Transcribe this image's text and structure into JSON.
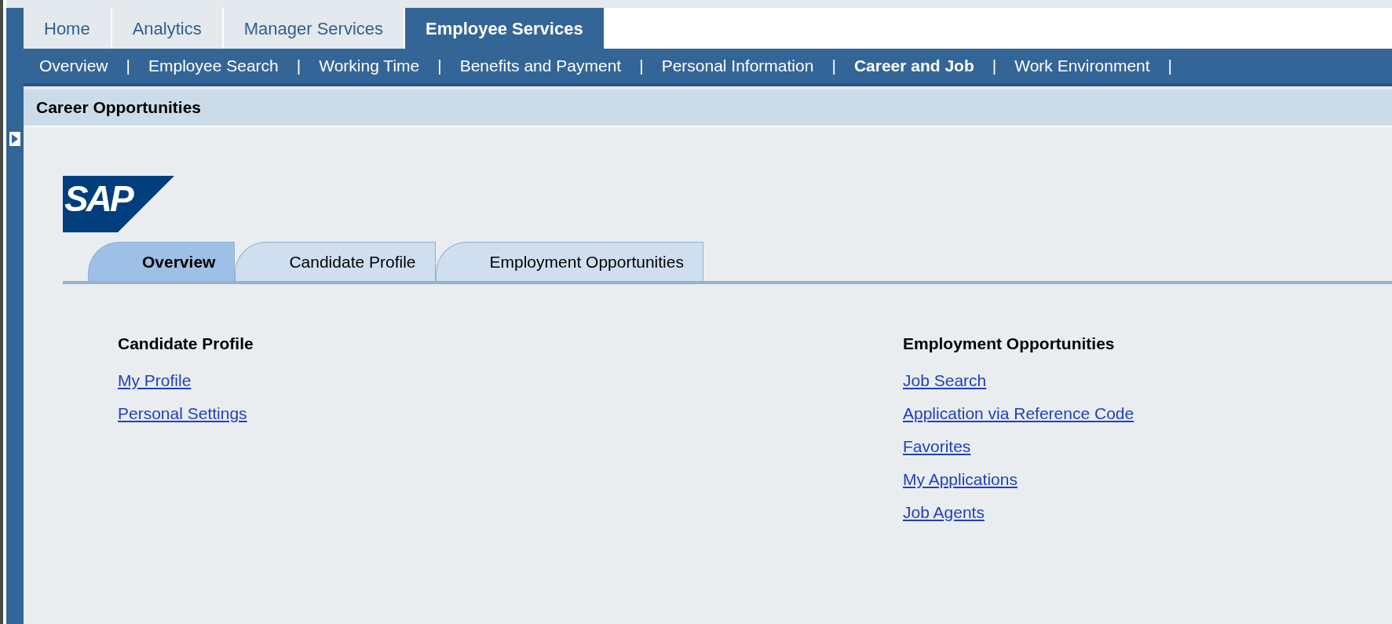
{
  "top_tabs": [
    {
      "label": "Home",
      "selected": false
    },
    {
      "label": "Analytics",
      "selected": false
    },
    {
      "label": "Manager Services",
      "selected": false
    },
    {
      "label": "Employee Services",
      "selected": true
    }
  ],
  "sub_nav": [
    {
      "label": "Overview",
      "selected": false
    },
    {
      "label": "Employee Search",
      "selected": false
    },
    {
      "label": "Working Time",
      "selected": false
    },
    {
      "label": "Benefits and Payment",
      "selected": false
    },
    {
      "label": "Personal Information",
      "selected": false
    },
    {
      "label": "Career and Job",
      "selected": true
    },
    {
      "label": "Work Environment",
      "selected": false
    }
  ],
  "sub_nav_separator": "|",
  "page_title": "Career Opportunities",
  "logo": "SAP",
  "tabs": [
    {
      "label": "Overview",
      "selected": true
    },
    {
      "label": "Candidate Profile",
      "selected": false
    },
    {
      "label": "Employment Opportunities",
      "selected": false
    }
  ],
  "sections": [
    {
      "heading": "Candidate Profile",
      "links": [
        "My Profile",
        "Personal Settings"
      ]
    },
    {
      "heading": "Employment Opportunities",
      "links": [
        "Job Search",
        "Application via Reference Code",
        "Favorites",
        "My Applications",
        "Job Agents"
      ]
    }
  ]
}
